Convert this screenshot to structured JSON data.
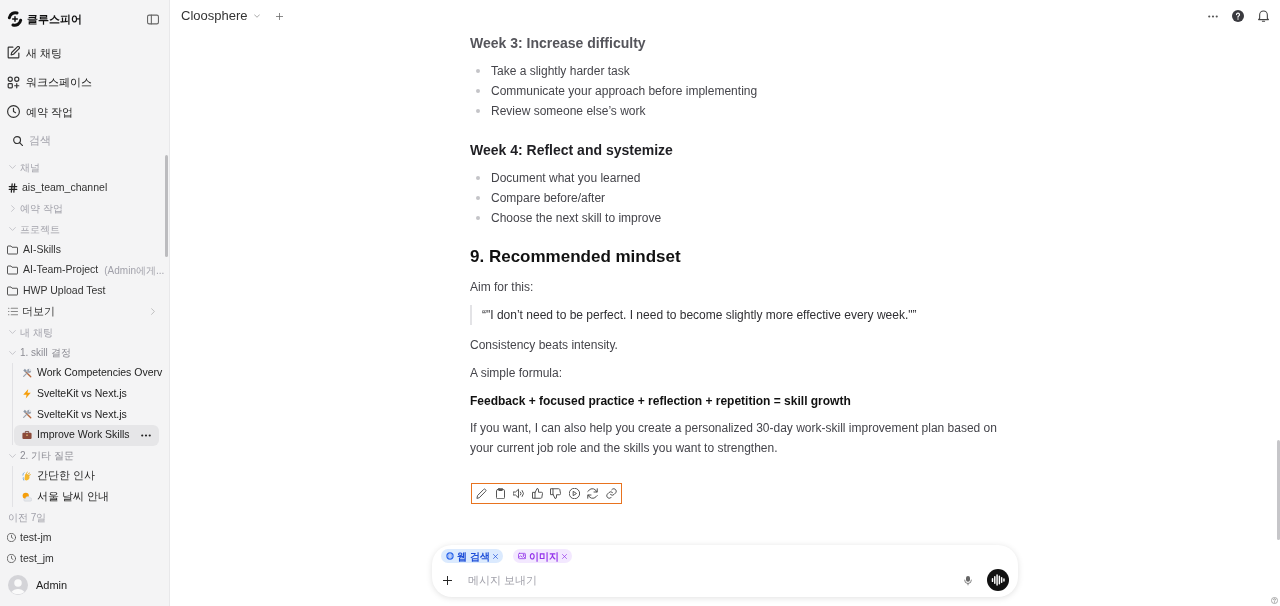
{
  "sidebar": {
    "brand": "클루스피어",
    "nav": [
      {
        "kind": "new-chat",
        "label": "새 채팅"
      },
      {
        "kind": "workspace",
        "label": "워크스페이스"
      },
      {
        "kind": "scheduled",
        "label": "예약 작업"
      }
    ],
    "search": {
      "placeholder": "검색"
    },
    "tree": [
      {
        "kind": "section",
        "label": "채널",
        "expanded": true,
        "children": [
          {
            "kind": "channel",
            "label": "ais_team_channel"
          }
        ]
      },
      {
        "kind": "section",
        "label": "예약 작업",
        "expanded": false
      },
      {
        "kind": "section",
        "label": "프로젝트",
        "expanded": true,
        "children": [
          {
            "kind": "project",
            "label": "AI-Skills"
          },
          {
            "kind": "project",
            "label": "AI-Team-Project",
            "note": "(Admin에게..."
          },
          {
            "kind": "project",
            "label": "HWP Upload Test"
          },
          {
            "kind": "more",
            "label": "더보기"
          }
        ]
      },
      {
        "kind": "section",
        "label": "내 채팅",
        "expanded": true,
        "children": [
          {
            "kind": "folder",
            "label": "1. skill 결정",
            "expanded": true,
            "children": [
              {
                "kind": "tools",
                "label": "Work Competencies Overv",
                "selected": false
              },
              {
                "kind": "bolt",
                "label": "SvelteKit vs Next.js",
                "selected": false
              },
              {
                "kind": "tools",
                "label": "SvelteKit vs Next.js",
                "selected": false
              },
              {
                "kind": "briefcase",
                "label": "Improve Work Skills",
                "selected": true
              }
            ]
          },
          {
            "kind": "folder",
            "label": "2. 기타 질문",
            "expanded": true,
            "children": [
              {
                "kind": "wave",
                "label": "간단한 인사",
                "selected": false
              },
              {
                "kind": "weather",
                "label": "서울 날씨 안내",
                "selected": false
              }
            ]
          }
        ]
      },
      {
        "kind": "group",
        "label": "이전 7일",
        "children": [
          {
            "kind": "history",
            "label": "test-jm"
          },
          {
            "kind": "history",
            "label": "test_jm"
          }
        ]
      }
    ],
    "user": {
      "name": "Admin"
    }
  },
  "topbar": {
    "title": "Cloosphere"
  },
  "message": {
    "blocks": [
      {
        "kind": "h3",
        "text": "Week 3: Increase difficulty"
      },
      {
        "kind": "list",
        "items": [
          "Take a slightly harder task",
          "Communicate your approach before implementing",
          "Review someone else’s work"
        ]
      },
      {
        "kind": "h3",
        "text": "Week 4: Reflect and systemize"
      },
      {
        "kind": "list",
        "items": [
          "Document what you learned",
          "Compare before/after",
          "Choose the next skill to improve"
        ]
      },
      {
        "kind": "h2",
        "text": "9. Recommended mindset"
      },
      {
        "kind": "p",
        "text": "Aim for this:"
      },
      {
        "kind": "quote",
        "text": "“\"I don’t need to be perfect. I need to become slightly more effective every week.\"”"
      },
      {
        "kind": "p",
        "text": "Consistency beats intensity."
      },
      {
        "kind": "p",
        "text": "A simple formula:"
      },
      {
        "kind": "strong",
        "text": "Feedback + focused practice + reflection + repetition = skill growth"
      },
      {
        "kind": "p",
        "text": "If you want, I can also help you create a personalized 30-day work-skill improvement plan based on your current job role and the skills you want to strengthen."
      }
    ]
  },
  "composer": {
    "chips": [
      {
        "kind": "web",
        "label": "웹 검색"
      },
      {
        "kind": "image",
        "label": "이미지"
      }
    ],
    "placeholder": "메시지 보내기"
  }
}
